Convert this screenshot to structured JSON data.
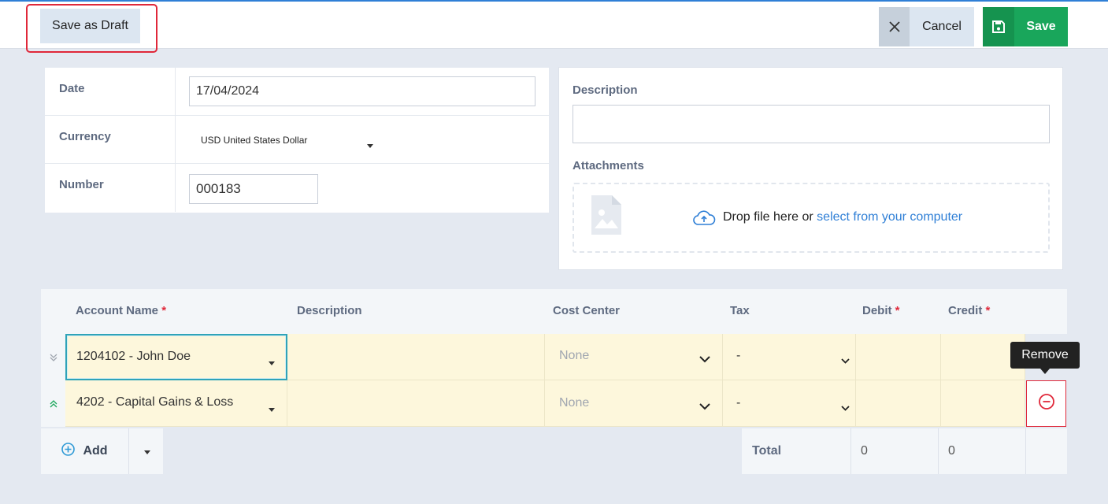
{
  "toolbar": {
    "save_draft_label": "Save as Draft",
    "cancel_label": "Cancel",
    "save_label": "Save"
  },
  "form": {
    "date_label": "Date",
    "date_value": "17/04/2024",
    "currency_label": "Currency",
    "currency_value": "USD United States Dollar",
    "number_label": "Number",
    "number_value": "000183",
    "description_label": "Description",
    "attachments_label": "Attachments",
    "drop_text": "Drop file here or",
    "select_link": "select from your computer"
  },
  "table": {
    "headers": {
      "account_name": "Account Name",
      "description": "Description",
      "cost_center": "Cost Center",
      "tax": "Tax",
      "debit": "Debit",
      "credit": "Credit",
      "required_mark": "*"
    },
    "rows": [
      {
        "account": "1204102 - John Doe",
        "cost_center": "None",
        "tax": "-"
      },
      {
        "account": "4202 - Capital Gains & Loss",
        "cost_center": "None",
        "tax": "-"
      }
    ],
    "add_label": "Add",
    "total_label": "Total",
    "total_debit": "0",
    "total_credit": "0",
    "remove_tooltip": "Remove"
  },
  "colors": {
    "accent": "#2f7fd6",
    "save_green": "#19a65b",
    "danger": "#e0283a",
    "row_fill": "#fdf7dc"
  }
}
